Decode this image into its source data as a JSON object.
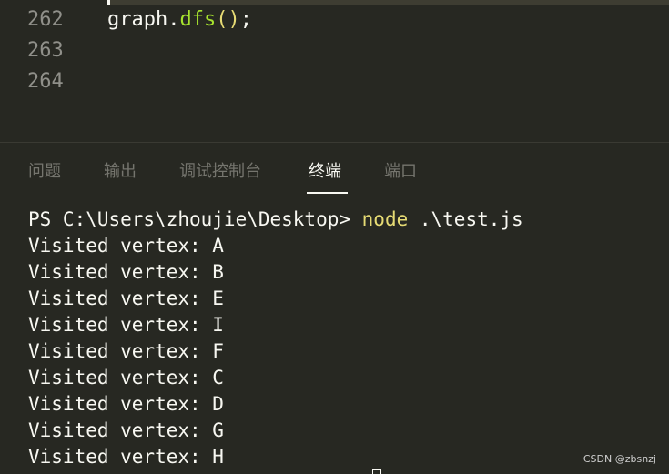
{
  "editor": {
    "lines": [
      {
        "num": "262",
        "code_obj": "graph.",
        "code_fn": "dfs",
        "code_paren": "()",
        "code_end": ";"
      },
      {
        "num": "263"
      },
      {
        "num": "264"
      }
    ]
  },
  "panel": {
    "tabs": [
      {
        "label": "问题",
        "active": false
      },
      {
        "label": "输出",
        "active": false
      },
      {
        "label": "调试控制台",
        "active": false
      },
      {
        "label": "终端",
        "active": true
      },
      {
        "label": "端口",
        "active": false
      }
    ]
  },
  "terminal": {
    "prompt": "PS C:\\Users\\zhoujie\\Desktop> ",
    "command": "node",
    "args": " .\\test.js",
    "output": [
      "Visited vertex: A",
      "Visited vertex: B",
      "Visited vertex: E",
      "Visited vertex: I",
      "Visited vertex: F",
      "Visited vertex: C",
      "Visited vertex: D",
      "Visited vertex: G",
      "Visited vertex: H"
    ]
  },
  "watermark": "CSDN @zbsnzj",
  "colors": {
    "background": "#272822",
    "text": "#f8f8f2",
    "function": "#a6e22e",
    "command": "#e6db74",
    "line_number": "#90908a",
    "inactive_tab": "#75756e"
  }
}
